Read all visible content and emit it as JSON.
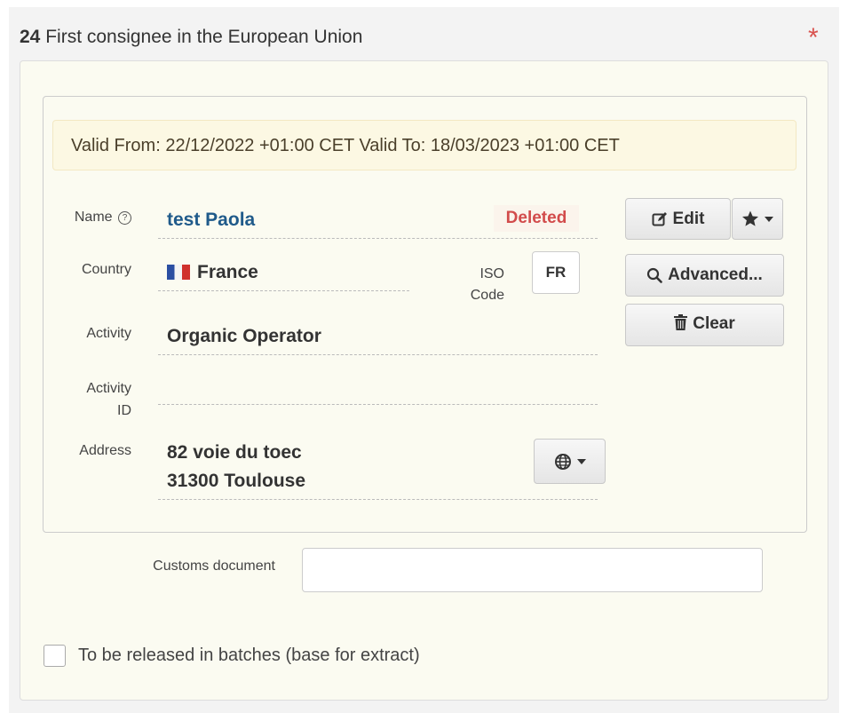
{
  "section": {
    "number": "24",
    "title": "First consignee in the European Union",
    "required_mark": "*"
  },
  "validity": "Valid From: 22/12/2022 +01:00 CET Valid To: 18/03/2023 +01:00 CET",
  "fields": {
    "name_label": "Name",
    "name_value": "test Paola",
    "status_badge": "Deleted",
    "country_label": "Country",
    "country_value": "France",
    "iso_label_line1": "ISO",
    "iso_label_line2": "Code",
    "iso_value": "FR",
    "activity_label": "Activity",
    "activity_value": "Organic Operator",
    "activity_id_label_line1": "Activity",
    "activity_id_label_line2": "ID",
    "activity_id_value": "",
    "address_label": "Address",
    "address_line1": "82 voie du toec",
    "address_line2": "31300 Toulouse"
  },
  "buttons": {
    "edit": "Edit",
    "advanced": "Advanced...",
    "clear": "Clear"
  },
  "customs": {
    "label": "Customs document",
    "value": ""
  },
  "batches_checkbox": {
    "label": "To be released in batches (base for extract)",
    "checked": false
  },
  "icons": {
    "help": "help-circle-icon",
    "flag": "france-flag-icon",
    "edit": "edit-icon",
    "star": "star-icon",
    "search": "search-icon",
    "trash": "trash-icon",
    "globe": "globe-icon"
  },
  "colors": {
    "panel_bg": "#fbfbf1",
    "validity_bg": "#fcf8e3",
    "name_value": "#1f5a8a",
    "deleted": "#d24b4b",
    "required": "#d9534f"
  }
}
